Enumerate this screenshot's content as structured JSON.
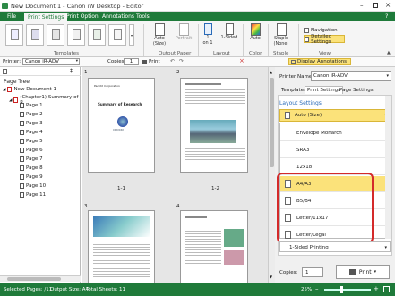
{
  "window": {
    "title": "New Document 1 - Canon iW Desktop - Editor"
  },
  "ribbon_tabs": [
    "File",
    "Print Settings",
    "Print Option",
    "Annotations",
    "Tools"
  ],
  "ribbon": {
    "templates_label": "Templates",
    "output_paper": {
      "label": "Output Paper",
      "auto_label": "Auto",
      "size_label": "(Size)",
      "portrait_label": "Portrait"
    },
    "layout": {
      "label": "Layout",
      "one_label": "1",
      "on1_label": "on 1",
      "sided_label": "1-Sided"
    },
    "color": {
      "label": "Color",
      "auto_label": "Auto"
    },
    "staple": {
      "label": "Staple",
      "staple_label": "Staple",
      "none_label": "(None)"
    },
    "view": {
      "label": "View",
      "navigation_label": "Navigation",
      "detailed_label": "Detailed Settings"
    }
  },
  "toolbar2": {
    "printer_label": "Printer:",
    "printer_value": "Canon iR-ADV",
    "copies_label": "Copies:",
    "copies_value": "1",
    "print_label": "Print",
    "display_annotations_label": "Display Annotations"
  },
  "page_tree": {
    "title": "Page Tree",
    "root": "New Document 1",
    "chapter": "(Chapter1) Summary of R",
    "pages": [
      "Page 1",
      "Page 2",
      "Page 3",
      "Page 4",
      "Page 5",
      "Page 6",
      "Page 7",
      "Page 8",
      "Page 9",
      "Page 10",
      "Page 11"
    ]
  },
  "thumbnails": {
    "page1_number": "1",
    "page2_number": "2",
    "page3_number": "3",
    "page4_number": "4",
    "page1_label": "1-1",
    "page2_label": "1-2",
    "page1_company": "Pac XX Corporation",
    "page1_heading": "Summary of Research",
    "page1_logo_text": "XXXXXXX"
  },
  "right_panel": {
    "printer_name_label": "Printer Name:",
    "printer_name_value": "Canon iR-ADV",
    "tabs": [
      "Templates",
      "Print Settings",
      "Page Settings"
    ],
    "layout_settings_label": "Layout Settings",
    "selected_size": "Auto (Size)",
    "size_options": [
      "Envelope Monarch",
      "SRA3",
      "12x18",
      "A4/A3",
      "B5/B4",
      "Letter/11x17",
      "Letter/Legal"
    ],
    "sided_value": "1-Sided Printing",
    "copies_label": "Copies:",
    "copies_value": "1",
    "print_label": "Print"
  },
  "statusbar": {
    "selected_pages": "Selected Pages: /11",
    "output_size": "Output Size: A4",
    "total_sheets": "Total Sheets: 11",
    "zoom": "25%"
  },
  "colors": {
    "accent_green": "#1f7a3a",
    "highlight_yellow": "#fbe27a",
    "red_outline": "#d42a2a"
  }
}
